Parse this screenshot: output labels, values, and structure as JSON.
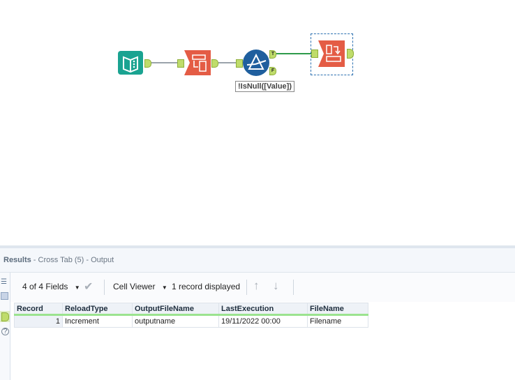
{
  "canvas": {
    "tools": [
      {
        "name": "input-data-tool",
        "color": "#1aa391"
      },
      {
        "name": "select-tool",
        "color": "#e45c45"
      },
      {
        "name": "filter-tool",
        "color": "#1f5f9e",
        "anchors": [
          "T",
          "F"
        ],
        "expression": "!IsNull([Value])"
      },
      {
        "name": "cross-tab-tool",
        "color": "#e45c45",
        "selected": true
      }
    ]
  },
  "results": {
    "title_bold": "Results",
    "title_rest": " - Cross Tab (5) - Output",
    "toolbar": {
      "fields": "4 of 4 Fields",
      "viewer": "Cell Viewer",
      "records": "1 record displayed"
    },
    "columns": [
      "Record",
      "ReloadType",
      "OutputFileName",
      "LastExecution",
      "FileName"
    ],
    "rows": [
      [
        "1",
        "Increment",
        "outputname",
        "19/11/2022 00:00",
        "Filename"
      ]
    ]
  }
}
